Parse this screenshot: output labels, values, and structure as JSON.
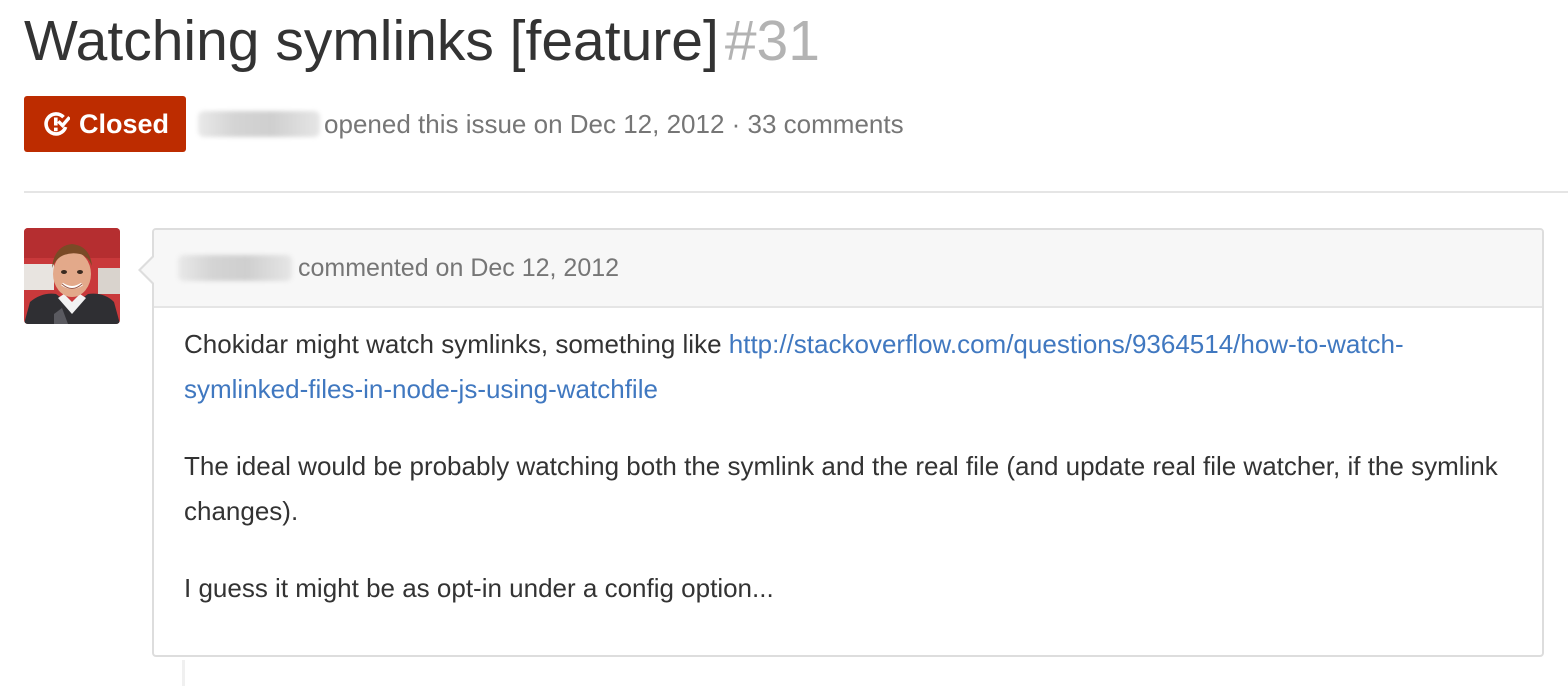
{
  "issue": {
    "title": "Watching symlinks [feature]",
    "number": "#31",
    "state_label": "Closed",
    "state_color": "#bd2c00",
    "meta_text": "opened this issue on Dec 12, 2012 · 33 comments"
  },
  "comment": {
    "meta_text": "commented on Dec 12, 2012",
    "paragraph1_prefix": "Chokidar might watch symlinks, something like ",
    "link_text": "http://stackoverflow.com/questions/9364514/how-to-watch-symlinked-files-in-node-js-using-watchfile",
    "link_href": "http://stackoverflow.com/questions/9364514/how-to-watch-symlinked-files-in-node-js-using-watchfile",
    "paragraph2": "The ideal would be probably watching both the symlink and the real file (and update real file watcher, if the symlink changes).",
    "paragraph3": "I guess it might be as opt-in under a config option..."
  },
  "icons": {
    "state": "issue-closed-icon",
    "avatar": "user-avatar"
  },
  "colors": {
    "link": "#4078c0",
    "muted_text": "#767676"
  }
}
